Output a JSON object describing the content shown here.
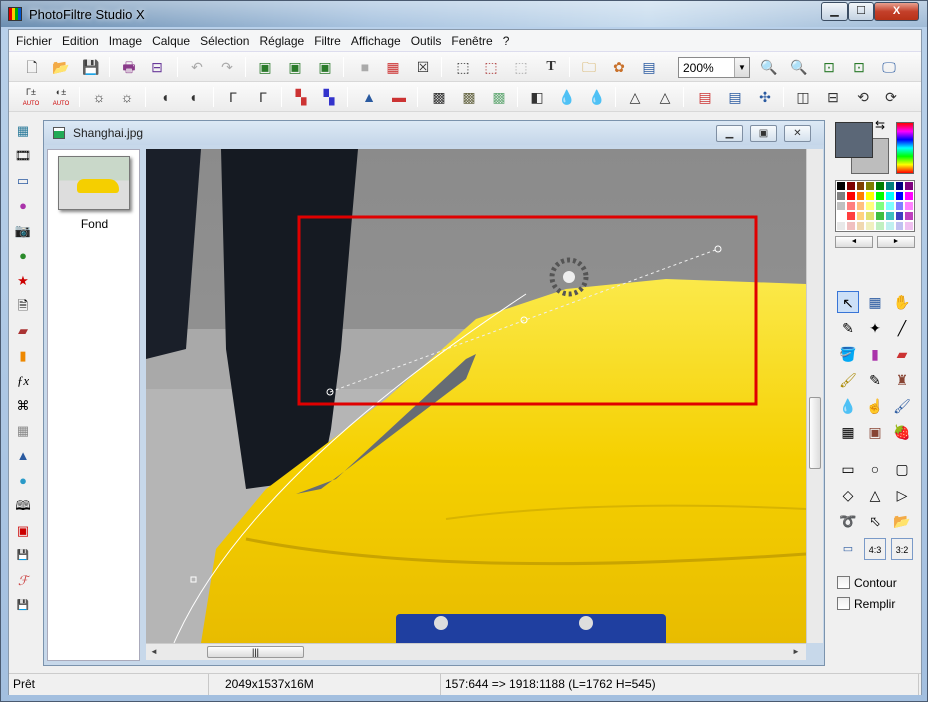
{
  "app": {
    "title": "PhotoFiltre Studio X"
  },
  "window_controls": {
    "minimize": "▁",
    "maximize": "☐",
    "close": "X"
  },
  "menu": [
    "Fichier",
    "Edition",
    "Image",
    "Calque",
    "Sélection",
    "Réglage",
    "Filtre",
    "Affichage",
    "Outils",
    "Fenêtre",
    "?"
  ],
  "toolbar": {
    "zoom_value": "200%",
    "zoom_arrow": "▼",
    "text_tool": "T",
    "gamma_auto_label": "AUTO"
  },
  "document": {
    "title": "Shanghai.jpg",
    "layer_name": "Fond"
  },
  "doc_controls": {
    "minimize": "▁",
    "maximize": "▣",
    "close": "✕"
  },
  "scroll": {
    "left": "◄",
    "right": "►",
    "thumb_grip": "|||"
  },
  "right_panel": {
    "contour_label": "Contour",
    "remplir_label": "Remplir",
    "ratio_43": "4:3",
    "ratio_32": "3:2"
  },
  "status": {
    "ready": "Prêt",
    "image_info": "2049x1537x16M",
    "selection_info": "157:644 => 1918:1188 (L=1762  H=545)"
  },
  "colors": {
    "selection_rect": "#e00000",
    "car_yellow": "#f5d000",
    "foreground": "#5b6777",
    "background": "#bdbdbd"
  },
  "palette": [
    "#000000",
    "#7f0000",
    "#7f3f00",
    "#7f7f00",
    "#007f00",
    "#007f7f",
    "#00007f",
    "#7f007f",
    "#7f7f7f",
    "#ff0000",
    "#ff7f00",
    "#ffff00",
    "#00ff00",
    "#00ffff",
    "#0000ff",
    "#ff00ff",
    "#c0c0c0",
    "#ff7f7f",
    "#ffbf7f",
    "#ffff7f",
    "#7fff7f",
    "#7fffff",
    "#7f7fff",
    "#ff7fff",
    "#ffffff",
    "#ff3f3f",
    "#ffd27f",
    "#e0e070",
    "#3fbf3f",
    "#3fbfbf",
    "#3f3fbf",
    "#bf3fbf",
    "#e8e8e8",
    "#f0c0c0",
    "#f0d8b0",
    "#f0f0c0",
    "#c0f0c0",
    "#c0f0f0",
    "#c0c0f0",
    "#f0c0f0"
  ]
}
